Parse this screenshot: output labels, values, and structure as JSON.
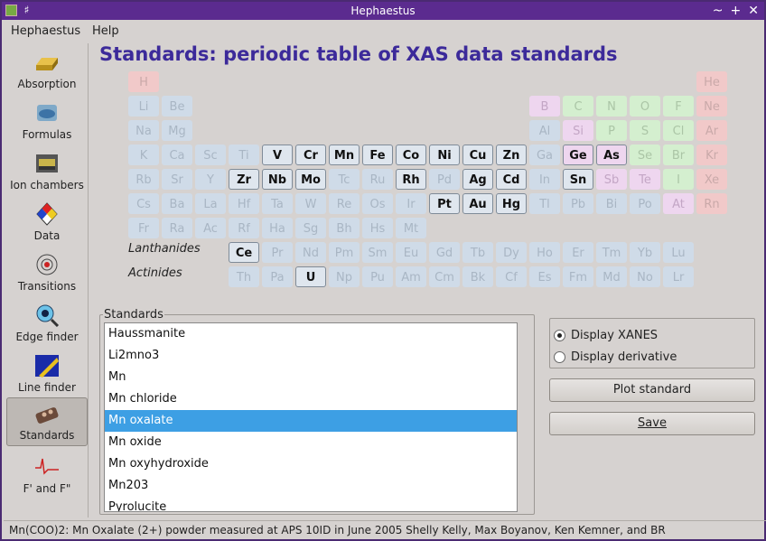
{
  "window": {
    "title": "Hephaestus"
  },
  "menu": {
    "items": [
      "Hephaestus",
      "Help"
    ]
  },
  "sidebar": {
    "items": [
      {
        "label": "Absorption",
        "icon": "gold-bar-icon"
      },
      {
        "label": "Formulas",
        "icon": "beaker-icon"
      },
      {
        "label": "Ion chambers",
        "icon": "ion-chamber-icon"
      },
      {
        "label": "Data",
        "icon": "hazard-diamond-icon"
      },
      {
        "label": "Transitions",
        "icon": "atom-icon"
      },
      {
        "label": "Edge finder",
        "icon": "magnifier-eye-icon"
      },
      {
        "label": "Line finder",
        "icon": "ruler-icon"
      },
      {
        "label": "Standards",
        "icon": "sample-case-icon"
      },
      {
        "label": "F' and F\"",
        "icon": "f-curve-icon"
      }
    ],
    "active": 7
  },
  "page": {
    "title": "Standards: periodic table of XAS data standards"
  },
  "periodic_table": {
    "lanthanides_label": "Lanthanides",
    "actinides_label": "Actinides",
    "elements": [
      {
        "s": "H",
        "r": 0,
        "c": 0,
        "t": "red"
      },
      {
        "s": "He",
        "r": 0,
        "c": 17,
        "t": "red"
      },
      {
        "s": "Li",
        "r": 1,
        "c": 0,
        "t": "dis"
      },
      {
        "s": "Be",
        "r": 1,
        "c": 1,
        "t": "dis"
      },
      {
        "s": "B",
        "r": 1,
        "c": 12,
        "t": "pnk"
      },
      {
        "s": "C",
        "r": 1,
        "c": 13,
        "t": "grn"
      },
      {
        "s": "N",
        "r": 1,
        "c": 14,
        "t": "grn"
      },
      {
        "s": "O",
        "r": 1,
        "c": 15,
        "t": "grn"
      },
      {
        "s": "F",
        "r": 1,
        "c": 16,
        "t": "grn"
      },
      {
        "s": "Ne",
        "r": 1,
        "c": 17,
        "t": "red"
      },
      {
        "s": "Na",
        "r": 2,
        "c": 0,
        "t": "dis"
      },
      {
        "s": "Mg",
        "r": 2,
        "c": 1,
        "t": "dis"
      },
      {
        "s": "Al",
        "r": 2,
        "c": 12,
        "t": "dis"
      },
      {
        "s": "Si",
        "r": 2,
        "c": 13,
        "t": "pnk"
      },
      {
        "s": "P",
        "r": 2,
        "c": 14,
        "t": "grn"
      },
      {
        "s": "S",
        "r": 2,
        "c": 15,
        "t": "grn"
      },
      {
        "s": "Cl",
        "r": 2,
        "c": 16,
        "t": "grn"
      },
      {
        "s": "Ar",
        "r": 2,
        "c": 17,
        "t": "red"
      },
      {
        "s": "K",
        "r": 3,
        "c": 0,
        "t": "dis"
      },
      {
        "s": "Ca",
        "r": 3,
        "c": 1,
        "t": "dis"
      },
      {
        "s": "Sc",
        "r": 3,
        "c": 2,
        "t": "dis"
      },
      {
        "s": "Ti",
        "r": 3,
        "c": 3,
        "t": "dis"
      },
      {
        "s": "V",
        "r": 3,
        "c": 4,
        "t": "en"
      },
      {
        "s": "Cr",
        "r": 3,
        "c": 5,
        "t": "en"
      },
      {
        "s": "Mn",
        "r": 3,
        "c": 6,
        "t": "en"
      },
      {
        "s": "Fe",
        "r": 3,
        "c": 7,
        "t": "en"
      },
      {
        "s": "Co",
        "r": 3,
        "c": 8,
        "t": "en"
      },
      {
        "s": "Ni",
        "r": 3,
        "c": 9,
        "t": "en"
      },
      {
        "s": "Cu",
        "r": 3,
        "c": 10,
        "t": "en"
      },
      {
        "s": "Zn",
        "r": 3,
        "c": 11,
        "t": "en"
      },
      {
        "s": "Ga",
        "r": 3,
        "c": 12,
        "t": "dis"
      },
      {
        "s": "Ge",
        "r": 3,
        "c": 13,
        "t": "pnk en"
      },
      {
        "s": "As",
        "r": 3,
        "c": 14,
        "t": "pnk en"
      },
      {
        "s": "Se",
        "r": 3,
        "c": 15,
        "t": "grn"
      },
      {
        "s": "Br",
        "r": 3,
        "c": 16,
        "t": "grn"
      },
      {
        "s": "Kr",
        "r": 3,
        "c": 17,
        "t": "red"
      },
      {
        "s": "Rb",
        "r": 4,
        "c": 0,
        "t": "dis"
      },
      {
        "s": "Sr",
        "r": 4,
        "c": 1,
        "t": "dis"
      },
      {
        "s": "Y",
        "r": 4,
        "c": 2,
        "t": "dis"
      },
      {
        "s": "Zr",
        "r": 4,
        "c": 3,
        "t": "en"
      },
      {
        "s": "Nb",
        "r": 4,
        "c": 4,
        "t": "en"
      },
      {
        "s": "Mo",
        "r": 4,
        "c": 5,
        "t": "en"
      },
      {
        "s": "Tc",
        "r": 4,
        "c": 6,
        "t": "dis"
      },
      {
        "s": "Ru",
        "r": 4,
        "c": 7,
        "t": "dis"
      },
      {
        "s": "Rh",
        "r": 4,
        "c": 8,
        "t": "en"
      },
      {
        "s": "Pd",
        "r": 4,
        "c": 9,
        "t": "dis"
      },
      {
        "s": "Ag",
        "r": 4,
        "c": 10,
        "t": "en"
      },
      {
        "s": "Cd",
        "r": 4,
        "c": 11,
        "t": "en"
      },
      {
        "s": "In",
        "r": 4,
        "c": 12,
        "t": "dis"
      },
      {
        "s": "Sn",
        "r": 4,
        "c": 13,
        "t": "en"
      },
      {
        "s": "Sb",
        "r": 4,
        "c": 14,
        "t": "pnk"
      },
      {
        "s": "Te",
        "r": 4,
        "c": 15,
        "t": "pnk"
      },
      {
        "s": "I",
        "r": 4,
        "c": 16,
        "t": "grn"
      },
      {
        "s": "Xe",
        "r": 4,
        "c": 17,
        "t": "red"
      },
      {
        "s": "Cs",
        "r": 5,
        "c": 0,
        "t": "dis"
      },
      {
        "s": "Ba",
        "r": 5,
        "c": 1,
        "t": "dis"
      },
      {
        "s": "La",
        "r": 5,
        "c": 2,
        "t": "dis"
      },
      {
        "s": "Hf",
        "r": 5,
        "c": 3,
        "t": "dis"
      },
      {
        "s": "Ta",
        "r": 5,
        "c": 4,
        "t": "dis"
      },
      {
        "s": "W",
        "r": 5,
        "c": 5,
        "t": "dis"
      },
      {
        "s": "Re",
        "r": 5,
        "c": 6,
        "t": "dis"
      },
      {
        "s": "Os",
        "r": 5,
        "c": 7,
        "t": "dis"
      },
      {
        "s": "Ir",
        "r": 5,
        "c": 8,
        "t": "dis"
      },
      {
        "s": "Pt",
        "r": 5,
        "c": 9,
        "t": "en"
      },
      {
        "s": "Au",
        "r": 5,
        "c": 10,
        "t": "en"
      },
      {
        "s": "Hg",
        "r": 5,
        "c": 11,
        "t": "en"
      },
      {
        "s": "Tl",
        "r": 5,
        "c": 12,
        "t": "dis"
      },
      {
        "s": "Pb",
        "r": 5,
        "c": 13,
        "t": "dis"
      },
      {
        "s": "Bi",
        "r": 5,
        "c": 14,
        "t": "dis"
      },
      {
        "s": "Po",
        "r": 5,
        "c": 15,
        "t": "dis"
      },
      {
        "s": "At",
        "r": 5,
        "c": 16,
        "t": "pnk"
      },
      {
        "s": "Rn",
        "r": 5,
        "c": 17,
        "t": "red"
      },
      {
        "s": "Fr",
        "r": 6,
        "c": 0,
        "t": "dis"
      },
      {
        "s": "Ra",
        "r": 6,
        "c": 1,
        "t": "dis"
      },
      {
        "s": "Ac",
        "r": 6,
        "c": 2,
        "t": "dis"
      },
      {
        "s": "Rf",
        "r": 6,
        "c": 3,
        "t": "dis"
      },
      {
        "s": "Ha",
        "r": 6,
        "c": 4,
        "t": "dis"
      },
      {
        "s": "Sg",
        "r": 6,
        "c": 5,
        "t": "dis"
      },
      {
        "s": "Bh",
        "r": 6,
        "c": 6,
        "t": "dis"
      },
      {
        "s": "Hs",
        "r": 6,
        "c": 7,
        "t": "dis"
      },
      {
        "s": "Mt",
        "r": 6,
        "c": 8,
        "t": "dis"
      },
      {
        "s": "Ce",
        "r": 7,
        "c": 3,
        "t": "en"
      },
      {
        "s": "Pr",
        "r": 7,
        "c": 4,
        "t": "dis"
      },
      {
        "s": "Nd",
        "r": 7,
        "c": 5,
        "t": "dis"
      },
      {
        "s": "Pm",
        "r": 7,
        "c": 6,
        "t": "dis"
      },
      {
        "s": "Sm",
        "r": 7,
        "c": 7,
        "t": "dis"
      },
      {
        "s": "Eu",
        "r": 7,
        "c": 8,
        "t": "dis"
      },
      {
        "s": "Gd",
        "r": 7,
        "c": 9,
        "t": "dis"
      },
      {
        "s": "Tb",
        "r": 7,
        "c": 10,
        "t": "dis"
      },
      {
        "s": "Dy",
        "r": 7,
        "c": 11,
        "t": "dis"
      },
      {
        "s": "Ho",
        "r": 7,
        "c": 12,
        "t": "dis"
      },
      {
        "s": "Er",
        "r": 7,
        "c": 13,
        "t": "dis"
      },
      {
        "s": "Tm",
        "r": 7,
        "c": 14,
        "t": "dis"
      },
      {
        "s": "Yb",
        "r": 7,
        "c": 15,
        "t": "dis"
      },
      {
        "s": "Lu",
        "r": 7,
        "c": 16,
        "t": "dis"
      },
      {
        "s": "Th",
        "r": 8,
        "c": 3,
        "t": "dis"
      },
      {
        "s": "Pa",
        "r": 8,
        "c": 4,
        "t": "dis"
      },
      {
        "s": "U",
        "r": 8,
        "c": 5,
        "t": "en"
      },
      {
        "s": "Np",
        "r": 8,
        "c": 6,
        "t": "dis"
      },
      {
        "s": "Pu",
        "r": 8,
        "c": 7,
        "t": "dis"
      },
      {
        "s": "Am",
        "r": 8,
        "c": 8,
        "t": "dis"
      },
      {
        "s": "Cm",
        "r": 8,
        "c": 9,
        "t": "dis"
      },
      {
        "s": "Bk",
        "r": 8,
        "c": 10,
        "t": "dis"
      },
      {
        "s": "Cf",
        "r": 8,
        "c": 11,
        "t": "dis"
      },
      {
        "s": "Es",
        "r": 8,
        "c": 12,
        "t": "dis"
      },
      {
        "s": "Fm",
        "r": 8,
        "c": 13,
        "t": "dis"
      },
      {
        "s": "Md",
        "r": 8,
        "c": 14,
        "t": "dis"
      },
      {
        "s": "No",
        "r": 8,
        "c": 15,
        "t": "dis"
      },
      {
        "s": "Lr",
        "r": 8,
        "c": 16,
        "t": "dis"
      }
    ]
  },
  "standards": {
    "label": "Standards",
    "items": [
      "Haussmanite",
      "Li2mno3",
      "Mn",
      "Mn chloride",
      "Mn oxalate",
      "Mn oxide",
      "Mn oxyhydroxide",
      "Mn203",
      "Pyrolucite"
    ],
    "selected": 4
  },
  "options": {
    "display_xanes": "Display XANES",
    "display_derivative": "Display derivative",
    "selected": "display_xanes"
  },
  "buttons": {
    "plot": "Plot standard",
    "save": "Save"
  },
  "status": {
    "text": "Mn(COO)2: Mn Oxalate (2+) powder measured at APS 10ID in June 2005 Shelly Kelly, Max Boyanov, Ken Kemner, and BR"
  }
}
